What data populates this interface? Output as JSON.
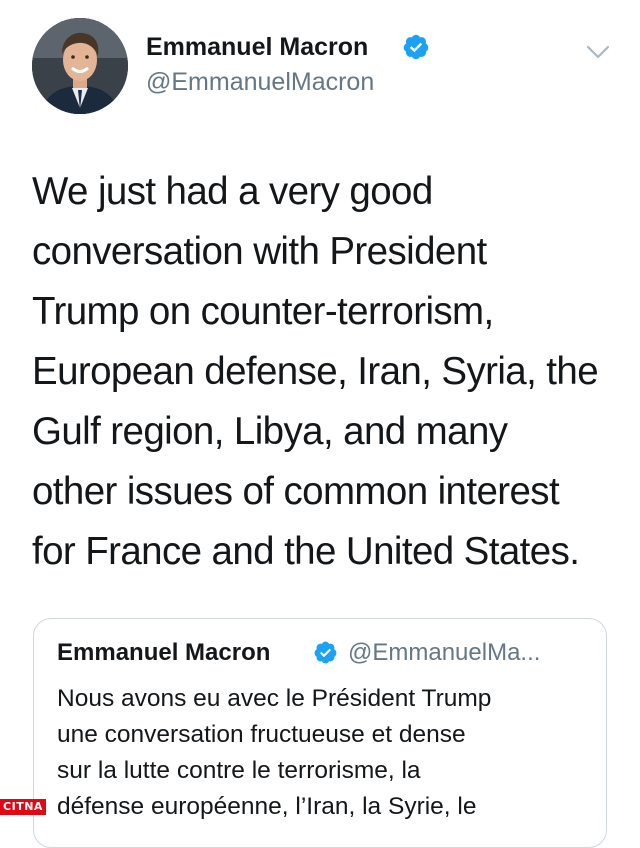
{
  "author": {
    "name": "Emmanuel Macron",
    "handle": "@EmmanuelMacron",
    "verified_icon": "verified-badge-icon"
  },
  "menu_icon": "chevron-down-icon",
  "tweet": {
    "lines": [
      "We just had a very good",
      "conversation with President",
      "Trump on counter-terrorism,",
      "European defense, Iran, Syria, the",
      "Gulf region, Libya, and many",
      "other issues of common interest",
      "for France and the United States."
    ]
  },
  "quoted_tweet": {
    "name": "Emmanuel Macron",
    "handle": "@EmmanuelMa...",
    "lines": [
      "Nous avons eu avec le Président Trump",
      "une conversation fructueuse et dense",
      "sur la lutte contre le terrorisme, la",
      "défense européenne, l’Iran, la Syrie, le"
    ]
  },
  "watermark": "CITNA",
  "colors": {
    "verified_blue": "#1da1f2",
    "secondary_text": "#657786",
    "primary_text": "#14171a",
    "card_border": "#cfd9de",
    "watermark_red": "#e30613"
  }
}
